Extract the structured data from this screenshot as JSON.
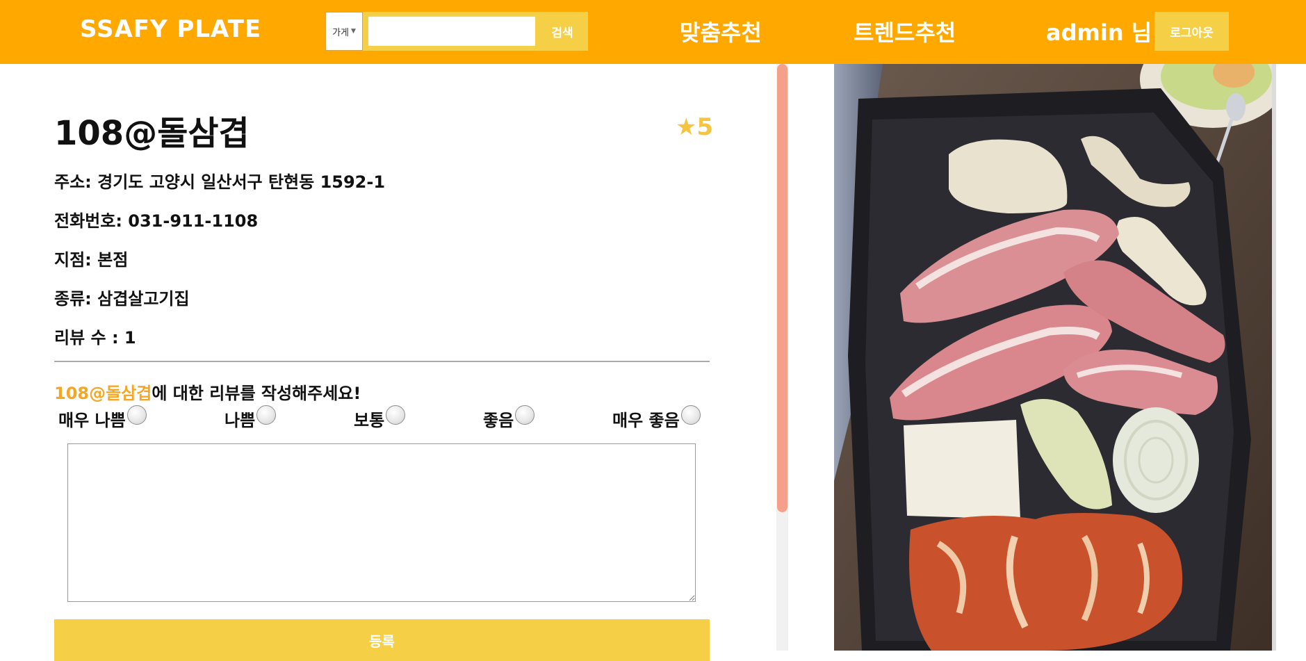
{
  "header": {
    "brand": "SSAFY PLATE",
    "search_category": "가게",
    "search_query": "",
    "search_button": "검색",
    "nav_custom": "맞춤추천",
    "nav_trend": "트렌드추천",
    "user_greeting": "admin 님",
    "logout_button": "로그아웃"
  },
  "restaurant": {
    "name": "108@돌삼겹",
    "rating": "★5",
    "address": "주소: 경기도 고양시 일산서구 탄현동 1592-1",
    "phone": "전화번호: 031-911-1108",
    "branch": "지점: 본점",
    "category": "종류: 삼겹살고기집",
    "review_count": "리뷰 수 : 1"
  },
  "review_form": {
    "prompt_name": "108@돌삼겹",
    "prompt_suffix": "에 대한 리뷰를 작성해주세요!",
    "options": [
      "매우 나쁨",
      "나쁨",
      "보통",
      "좋음",
      "매우 좋음"
    ],
    "text": "",
    "submit_label": "등록"
  },
  "photo": {
    "icon": "food-photo-samgyeopsal"
  },
  "colors": {
    "header_bg": "#ffa800",
    "accent": "#f5cf45",
    "highlight": "#f5a623",
    "rating": "#f5c542",
    "scroll_thumb": "#f5a08a"
  }
}
